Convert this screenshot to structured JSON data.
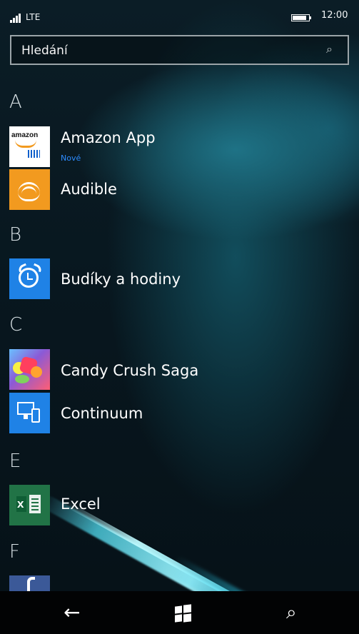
{
  "status": {
    "network": "LTE",
    "time": "12:00",
    "battery_level": 0.85
  },
  "search": {
    "placeholder": "Hledání",
    "icon": "search-icon"
  },
  "sections": [
    {
      "letter": "A",
      "apps": [
        {
          "name": "Amazon App",
          "sublabel": "Nové",
          "icon": "amazon-app-icon",
          "tile_color": "#ffffff",
          "tile_text": "amazon"
        },
        {
          "name": "Audible",
          "icon": "audible-icon",
          "tile_color": "#f29a1f"
        }
      ]
    },
    {
      "letter": "B",
      "apps": [
        {
          "name": "Budíky a hodiny",
          "icon": "alarm-clock-icon",
          "tile_color": "#1f82e6"
        }
      ]
    },
    {
      "letter": "C",
      "apps": [
        {
          "name": "Candy Crush Saga",
          "icon": "candy-crush-icon",
          "tile_color": "#8b5ad6"
        },
        {
          "name": "Continuum",
          "icon": "continuum-icon",
          "tile_color": "#1f82e6"
        }
      ]
    },
    {
      "letter": "E",
      "apps": [
        {
          "name": "Excel",
          "icon": "excel-icon",
          "tile_color": "#217346"
        }
      ]
    },
    {
      "letter": "F",
      "apps": [
        {
          "name": "",
          "icon": "facebook-icon",
          "tile_color": "#3b5998"
        }
      ]
    }
  ],
  "navbar": {
    "back_icon": "back-arrow-icon",
    "start_icon": "windows-start-icon",
    "search_icon": "search-icon"
  }
}
